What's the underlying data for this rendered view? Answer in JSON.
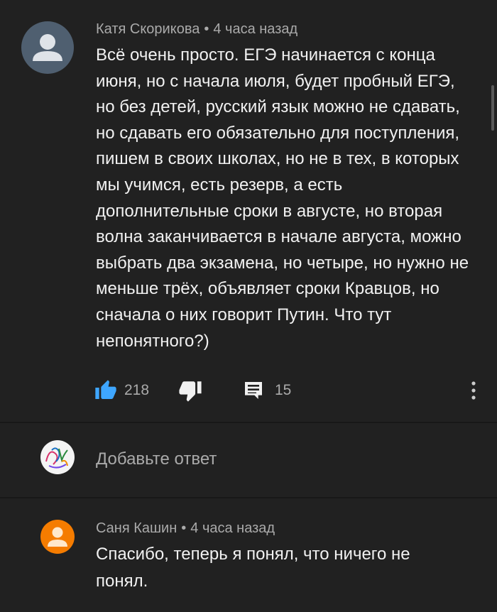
{
  "comment": {
    "author": "Катя Скорикова",
    "separator": "•",
    "time": "4 часа назад",
    "text": "Всё очень просто. ЕГЭ начинается с конца июня, но с начала июля, будет пробный ЕГЭ, но без детей, русский язык можно не сдавать, но сдавать его обязательно для поступления, пишем в своих школах, но не в тех, в которых мы учимся, есть резерв, а есть дополнительные сроки в августе, но вторая волна заканчивается в начале августа, можно выбрать два экзамена, но четыре, но нужно не меньше трёх, объявляет сроки Кравцов, но сначала о них говорит Путин. Что тут непонятного?)",
    "likes": "218",
    "replies": "15",
    "icons": {
      "avatar": "user-avatar-icon",
      "like": "thumbs-up-icon",
      "dislike": "thumbs-down-icon",
      "reply": "comment-icon",
      "menu": "more-vert-icon"
    },
    "colors": {
      "like_active": "#3ea6ff",
      "avatar_bg": "#4f5f70"
    }
  },
  "add_reply": {
    "placeholder": "Добавьте ответ"
  },
  "reply": {
    "author": "Саня Кашин",
    "separator": "•",
    "time": "4 часа назад",
    "text": "Спасибо, теперь я понял, что ничего не понял.",
    "colors": {
      "avatar_bg": "#f57c00"
    }
  }
}
